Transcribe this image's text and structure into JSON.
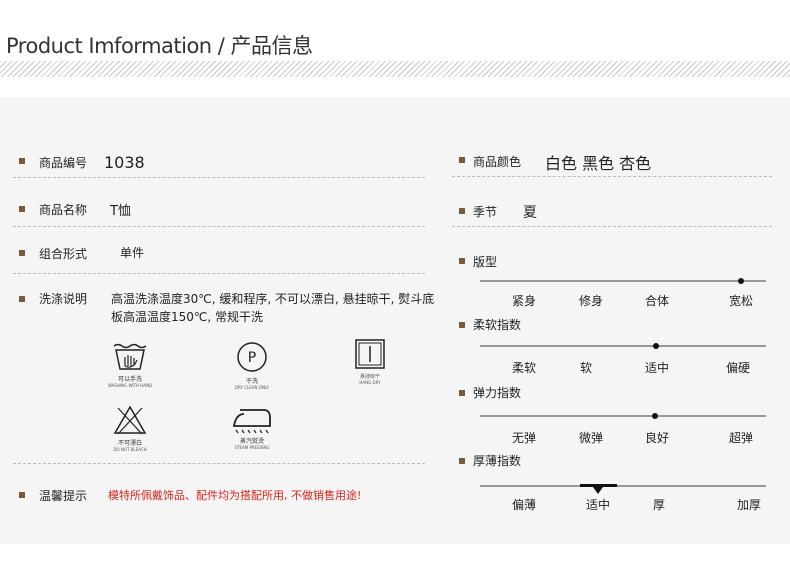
{
  "header": {
    "title": "Product Imformation / 产品信息"
  },
  "left": {
    "code": {
      "label": "商品编号",
      "value": "1038"
    },
    "name": {
      "label": "商品名称",
      "value": "T恤"
    },
    "style": {
      "label": "组合形式",
      "value": "单件"
    },
    "wash": {
      "label": "洗涤说明",
      "text": "高温洗涤温度30℃, 缓和程序, 不可以漂白, 悬挂晾干, 熨斗底板高温温度150℃, 常规干洗"
    },
    "care_icons": [
      {
        "icon": "hand-wash-icon",
        "cn": "可以手洗",
        "en": "WASHING WITH HAND"
      },
      {
        "icon": "dry-clean-icon",
        "letter": "P",
        "cn": "干洗",
        "en": "DRY CLEAN ONLY"
      },
      {
        "icon": "hang-dry-icon",
        "cn": "悬挂晾干",
        "en": "HANG DRY"
      },
      {
        "icon": "no-bleach-icon",
        "cn": "不可漂白",
        "en": "DO NOT BLEACH"
      },
      {
        "icon": "steam-iron-icon",
        "cn": "蒸汽熨烫",
        "en": "STEAM PRESSING"
      }
    ],
    "tip": {
      "label": "温馨提示",
      "value": "模特所佩戴饰品、配件均为搭配所用, 不做销售用途!"
    }
  },
  "right": {
    "color": {
      "label": "商品颜色",
      "value": "白色 黑色 杏色"
    },
    "season": {
      "label": "季节",
      "value": "夏"
    },
    "fit": {
      "label": "版型",
      "options": [
        "紧身",
        "修身",
        "合体",
        "宽松"
      ],
      "selected_index": 3
    },
    "softness": {
      "label": "柔软指数",
      "options": [
        "柔软",
        "软",
        "适中",
        "偏硬"
      ],
      "selected_index": 2
    },
    "elasticity": {
      "label": "弹力指数",
      "options": [
        "无弹",
        "微弹",
        "良好",
        "超弹"
      ],
      "selected_index": 2
    },
    "thickness": {
      "label": "厚薄指数",
      "options": [
        "偏薄",
        "适中",
        "厚",
        "加厚"
      ],
      "selected_index": 1
    }
  },
  "colors": {
    "bullet": "#7b5a3b",
    "tip": "#d8231d",
    "panel": "#f5f5f5"
  }
}
